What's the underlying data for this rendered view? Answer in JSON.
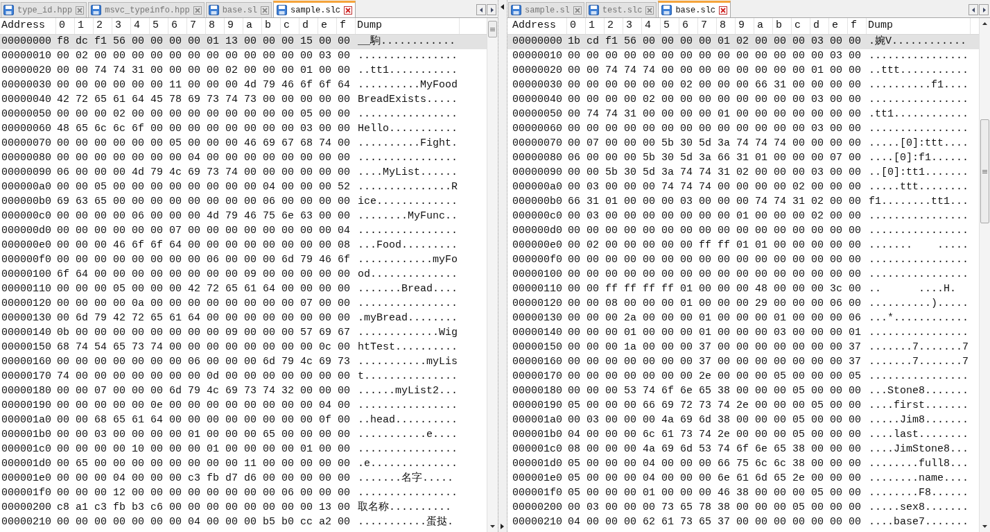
{
  "panes": [
    {
      "tabs": [
        {
          "label": "type_id.hpp",
          "selected": false
        },
        {
          "label": "msvc_typeinfo.hpp",
          "selected": false
        },
        {
          "label": "base.sl",
          "selected": false
        },
        {
          "label": "sample.slc",
          "selected": true
        }
      ],
      "columns": [
        "Address",
        "0",
        "1",
        "2",
        "3",
        "4",
        "5",
        "6",
        "7",
        "8",
        "9",
        "a",
        "b",
        "c",
        "d",
        "e",
        "f",
        "Dump"
      ],
      "rows": [
        {
          "address": "00000000",
          "bytes": "f8 dc f1 56 00 00 00 00 01 13 00 00 00 15 00 00",
          "dump": "__駒............",
          "selected": true
        },
        {
          "address": "00000010",
          "bytes": "00 02 00 00 00 00 00 00 00 00 00 00 00 00 03 00",
          "dump": "................",
          "selected": false
        },
        {
          "address": "00000020",
          "bytes": "00 00 74 74 31 00 00 00 00 02 00 00 00 01 00 00",
          "dump": "..tt1...........",
          "selected": false
        },
        {
          "address": "00000030",
          "bytes": "00 00 00 00 00 00 11 00 00 00 4d 79 46 6f 6f 64",
          "dump": "..........MyFood",
          "selected": false
        },
        {
          "address": "00000040",
          "bytes": "42 72 65 61 64 45 78 69 73 74 73 00 00 00 00 00",
          "dump": "BreadExists.....",
          "selected": false
        },
        {
          "address": "00000050",
          "bytes": "00 00 00 02 00 00 00 00 00 00 00 00 00 05 00 00",
          "dump": "................",
          "selected": false
        },
        {
          "address": "00000060",
          "bytes": "48 65 6c 6c 6f 00 00 00 00 00 00 00 00 03 00 00",
          "dump": "Hello...........",
          "selected": false
        },
        {
          "address": "00000070",
          "bytes": "00 00 00 00 00 00 05 00 00 00 46 69 67 68 74 00",
          "dump": "..........Fight.",
          "selected": false
        },
        {
          "address": "00000080",
          "bytes": "00 00 00 00 00 00 00 04 00 00 00 00 00 00 00 00",
          "dump": "................",
          "selected": false
        },
        {
          "address": "00000090",
          "bytes": "06 00 00 00 4d 79 4c 69 73 74 00 00 00 00 00 00",
          "dump": "....MyList......",
          "selected": false
        },
        {
          "address": "000000a0",
          "bytes": "00 00 05 00 00 00 00 00 00 00 00 04 00 00 00 52",
          "dump": "...............R",
          "selected": false
        },
        {
          "address": "000000b0",
          "bytes": "69 63 65 00 00 00 00 00 00 00 00 06 00 00 00 00",
          "dump": "ice.............",
          "selected": false
        },
        {
          "address": "000000c0",
          "bytes": "00 00 00 00 06 00 00 00 4d 79 46 75 6e 63 00 00",
          "dump": "........MyFunc..",
          "selected": false
        },
        {
          "address": "000000d0",
          "bytes": "00 00 00 00 00 00 07 00 00 00 00 00 00 00 00 04",
          "dump": "................",
          "selected": false
        },
        {
          "address": "000000e0",
          "bytes": "00 00 00 46 6f 6f 64 00 00 00 00 00 00 00 00 08",
          "dump": "...Food.........",
          "selected": false
        },
        {
          "address": "000000f0",
          "bytes": "00 00 00 00 00 00 00 00 06 00 00 00 6d 79 46 6f",
          "dump": "............myFo",
          "selected": false
        },
        {
          "address": "00000100",
          "bytes": "6f 64 00 00 00 00 00 00 00 00 09 00 00 00 00 00",
          "dump": "od..............",
          "selected": false
        },
        {
          "address": "00000110",
          "bytes": "00 00 00 05 00 00 00 42 72 65 61 64 00 00 00 00",
          "dump": ".......Bread....",
          "selected": false
        },
        {
          "address": "00000120",
          "bytes": "00 00 00 00 0a 00 00 00 00 00 00 00 00 07 00 00",
          "dump": "................",
          "selected": false
        },
        {
          "address": "00000130",
          "bytes": "00 6d 79 42 72 65 61 64 00 00 00 00 00 00 00 00",
          "dump": ".myBread........",
          "selected": false
        },
        {
          "address": "00000140",
          "bytes": "0b 00 00 00 00 00 00 00 00 09 00 00 00 57 69 67",
          "dump": ".............Wig",
          "selected": false
        },
        {
          "address": "00000150",
          "bytes": "68 74 54 65 73 74 00 00 00 00 00 00 00 00 0c 00",
          "dump": "htTest..........",
          "selected": false
        },
        {
          "address": "00000160",
          "bytes": "00 00 00 00 00 00 00 06 00 00 00 6d 79 4c 69 73",
          "dump": "...........myLis",
          "selected": false
        },
        {
          "address": "00000170",
          "bytes": "74 00 00 00 00 00 00 00 0d 00 00 00 00 00 00 00",
          "dump": "t...............",
          "selected": false
        },
        {
          "address": "00000180",
          "bytes": "00 00 07 00 00 00 6d 79 4c 69 73 74 32 00 00 00",
          "dump": "......myList2...",
          "selected": false
        },
        {
          "address": "00000190",
          "bytes": "00 00 00 00 00 0e 00 00 00 00 00 00 00 00 04 00",
          "dump": "................",
          "selected": false
        },
        {
          "address": "000001a0",
          "bytes": "00 00 68 65 61 64 00 00 00 00 00 00 00 00 0f 00",
          "dump": "..head..........",
          "selected": false
        },
        {
          "address": "000001b0",
          "bytes": "00 00 03 00 00 00 00 01 00 00 00 65 00 00 00 00",
          "dump": "...........e....",
          "selected": false
        },
        {
          "address": "000001c0",
          "bytes": "00 00 00 00 10 00 00 00 01 00 00 00 00 01 00 00",
          "dump": "................",
          "selected": false
        },
        {
          "address": "000001d0",
          "bytes": "00 65 00 00 00 00 00 00 00 00 11 00 00 00 00 00",
          "dump": ".e..............",
          "selected": false
        },
        {
          "address": "000001e0",
          "bytes": "00 00 00 04 00 00 00 c3 fb d7 d6 00 00 00 00 00",
          "dump": ".......名字.....",
          "selected": false
        },
        {
          "address": "000001f0",
          "bytes": "00 00 00 12 00 00 00 00 00 00 00 00 06 00 00 00",
          "dump": "................",
          "selected": false
        },
        {
          "address": "00000200",
          "bytes": "c8 a1 c3 fb b3 c6 00 00 00 00 00 00 00 00 13 00",
          "dump": "取名称..........",
          "selected": false
        },
        {
          "address": "00000210",
          "bytes": "00 00 00 00 00 00 00 04 00 00 00 b5 b0 cc a2 00",
          "dump": "...........蛋挞.",
          "selected": false
        }
      ]
    },
    {
      "tabs": [
        {
          "label": "sample.sl",
          "selected": false
        },
        {
          "label": "test.slc",
          "selected": false
        },
        {
          "label": "base.slc",
          "selected": true
        }
      ],
      "columns": [
        "Address",
        "0",
        "1",
        "2",
        "3",
        "4",
        "5",
        "6",
        "7",
        "8",
        "9",
        "a",
        "b",
        "c",
        "d",
        "e",
        "f",
        "Dump"
      ],
      "rows": [
        {
          "address": "00000000",
          "bytes": "1b cd f1 56 00 00 00 00 01 02 00 00 00 03 00 00",
          "dump": ".婉V............",
          "selected": true
        },
        {
          "address": "00000010",
          "bytes": "00 00 00 00 00 00 00 00 00 00 00 00 00 00 03 00",
          "dump": "................",
          "selected": false
        },
        {
          "address": "00000020",
          "bytes": "00 00 74 74 74 00 00 00 00 00 00 00 00 01 00 00",
          "dump": "..ttt...........",
          "selected": false
        },
        {
          "address": "00000030",
          "bytes": "00 00 00 00 00 00 02 00 00 00 66 31 00 00 00 00",
          "dump": "..........f1....",
          "selected": false
        },
        {
          "address": "00000040",
          "bytes": "00 00 00 00 02 00 00 00 00 00 00 00 00 03 00 00",
          "dump": "................",
          "selected": false
        },
        {
          "address": "00000050",
          "bytes": "00 74 74 31 00 00 00 00 01 00 00 00 00 00 00 00",
          "dump": ".tt1............",
          "selected": false
        },
        {
          "address": "00000060",
          "bytes": "00 00 00 00 00 00 00 00 00 00 00 00 00 03 00 00",
          "dump": "................",
          "selected": false
        },
        {
          "address": "00000070",
          "bytes": "00 07 00 00 00 5b 30 5d 3a 74 74 74 00 00 00 00",
          "dump": ".....[0]:ttt....",
          "selected": false
        },
        {
          "address": "00000080",
          "bytes": "06 00 00 00 5b 30 5d 3a 66 31 01 00 00 00 07 00",
          "dump": "....[0]:f1......",
          "selected": false
        },
        {
          "address": "00000090",
          "bytes": "00 00 5b 30 5d 3a 74 74 31 02 00 00 00 03 00 00",
          "dump": "..[0]:tt1.......",
          "selected": false
        },
        {
          "address": "000000a0",
          "bytes": "00 03 00 00 00 74 74 74 00 00 00 00 02 00 00 00",
          "dump": ".....ttt........",
          "selected": false
        },
        {
          "address": "000000b0",
          "bytes": "66 31 01 00 00 00 03 00 00 00 74 74 31 02 00 00",
          "dump": "f1........tt1...",
          "selected": false
        },
        {
          "address": "000000c0",
          "bytes": "00 03 00 00 00 00 00 00 00 01 00 00 00 02 00 00",
          "dump": "................",
          "selected": false
        },
        {
          "address": "000000d0",
          "bytes": "00 00 00 00 00 00 00 00 00 00 00 00 00 00 00 00",
          "dump": "................",
          "selected": false
        },
        {
          "address": "000000e0",
          "bytes": "00 02 00 00 00 00 00 ff ff 01 01 00 00 00 00 00",
          "dump": ".......    .....",
          "selected": false
        },
        {
          "address": "000000f0",
          "bytes": "00 00 00 00 00 00 00 00 00 00 00 00 00 00 00 00",
          "dump": "................",
          "selected": false
        },
        {
          "address": "00000100",
          "bytes": "00 00 00 00 00 00 00 00 00 00 00 00 00 00 00 00",
          "dump": "................",
          "selected": false
        },
        {
          "address": "00000110",
          "bytes": "00 00 ff ff ff ff 01 00 00 00 48 00 00 00 3c 00",
          "dump": "..      ....H.",
          "selected": false
        },
        {
          "address": "00000120",
          "bytes": "00 00 08 00 00 00 01 00 00 00 29 00 00 00 06 00",
          "dump": "..........).....",
          "selected": false
        },
        {
          "address": "00000130",
          "bytes": "00 00 00 2a 00 00 00 01 00 00 00 01 00 00 00 06",
          "dump": "...*............",
          "selected": false
        },
        {
          "address": "00000140",
          "bytes": "00 00 00 01 00 00 00 01 00 00 00 03 00 00 00 01",
          "dump": "................",
          "selected": false
        },
        {
          "address": "00000150",
          "bytes": "00 00 00 1a 00 00 00 37 00 00 00 00 00 00 00 37",
          "dump": ".......7.......7",
          "selected": false
        },
        {
          "address": "00000160",
          "bytes": "00 00 00 00 00 00 00 37 00 00 00 00 00 00 00 37",
          "dump": ".......7.......7",
          "selected": false
        },
        {
          "address": "00000170",
          "bytes": "00 00 00 00 00 00 00 2e 00 00 00 05 00 00 00 05",
          "dump": "................",
          "selected": false
        },
        {
          "address": "00000180",
          "bytes": "00 00 00 53 74 6f 6e 65 38 00 00 00 05 00 00 00",
          "dump": "...Stone8.......",
          "selected": false
        },
        {
          "address": "00000190",
          "bytes": "05 00 00 00 66 69 72 73 74 2e 00 00 00 05 00 00",
          "dump": "....first.......",
          "selected": false
        },
        {
          "address": "000001a0",
          "bytes": "00 03 00 00 00 4a 69 6d 38 00 00 00 05 00 00 00",
          "dump": ".....Jim8.......",
          "selected": false
        },
        {
          "address": "000001b0",
          "bytes": "04 00 00 00 6c 61 73 74 2e 00 00 00 05 00 00 00",
          "dump": "....last........",
          "selected": false
        },
        {
          "address": "000001c0",
          "bytes": "08 00 00 00 4a 69 6d 53 74 6f 6e 65 38 00 00 00",
          "dump": "....JimStone8...",
          "selected": false
        },
        {
          "address": "000001d0",
          "bytes": "05 00 00 00 04 00 00 00 66 75 6c 6c 38 00 00 00",
          "dump": "........full8...",
          "selected": false
        },
        {
          "address": "000001e0",
          "bytes": "05 00 00 00 04 00 00 00 6e 61 6d 65 2e 00 00 00",
          "dump": "........name....",
          "selected": false
        },
        {
          "address": "000001f0",
          "bytes": "05 00 00 00 01 00 00 00 46 38 00 00 00 05 00 00",
          "dump": "........F8......",
          "selected": false
        },
        {
          "address": "00000200",
          "bytes": "00 03 00 00 00 73 65 78 38 00 00 00 05 00 00 00",
          "dump": ".....sex8.......",
          "selected": false
        },
        {
          "address": "00000210",
          "bytes": "04 00 00 00 62 61 73 65 37 00 00 00 00 00 00 00",
          "dump": "....base7.......",
          "selected": false
        }
      ]
    }
  ]
}
